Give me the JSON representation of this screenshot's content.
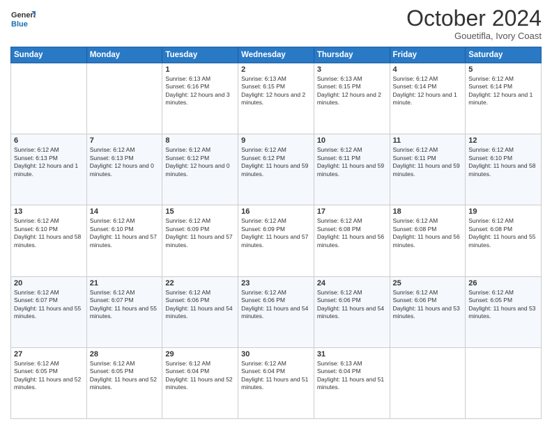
{
  "logo": {
    "line1": "General",
    "line2": "Blue"
  },
  "title": "October 2024",
  "subtitle": "Gouetifla, Ivory Coast",
  "days": [
    "Sunday",
    "Monday",
    "Tuesday",
    "Wednesday",
    "Thursday",
    "Friday",
    "Saturday"
  ],
  "weeks": [
    [
      {
        "day": "",
        "content": ""
      },
      {
        "day": "",
        "content": ""
      },
      {
        "day": "1",
        "content": "Sunrise: 6:13 AM\nSunset: 6:16 PM\nDaylight: 12 hours and 3 minutes."
      },
      {
        "day": "2",
        "content": "Sunrise: 6:13 AM\nSunset: 6:15 PM\nDaylight: 12 hours and 2 minutes."
      },
      {
        "day": "3",
        "content": "Sunrise: 6:13 AM\nSunset: 6:15 PM\nDaylight: 12 hours and 2 minutes."
      },
      {
        "day": "4",
        "content": "Sunrise: 6:12 AM\nSunset: 6:14 PM\nDaylight: 12 hours and 1 minute."
      },
      {
        "day": "5",
        "content": "Sunrise: 6:12 AM\nSunset: 6:14 PM\nDaylight: 12 hours and 1 minute."
      }
    ],
    [
      {
        "day": "6",
        "content": "Sunrise: 6:12 AM\nSunset: 6:13 PM\nDaylight: 12 hours and 1 minute."
      },
      {
        "day": "7",
        "content": "Sunrise: 6:12 AM\nSunset: 6:13 PM\nDaylight: 12 hours and 0 minutes."
      },
      {
        "day": "8",
        "content": "Sunrise: 6:12 AM\nSunset: 6:12 PM\nDaylight: 12 hours and 0 minutes."
      },
      {
        "day": "9",
        "content": "Sunrise: 6:12 AM\nSunset: 6:12 PM\nDaylight: 11 hours and 59 minutes."
      },
      {
        "day": "10",
        "content": "Sunrise: 6:12 AM\nSunset: 6:11 PM\nDaylight: 11 hours and 59 minutes."
      },
      {
        "day": "11",
        "content": "Sunrise: 6:12 AM\nSunset: 6:11 PM\nDaylight: 11 hours and 59 minutes."
      },
      {
        "day": "12",
        "content": "Sunrise: 6:12 AM\nSunset: 6:10 PM\nDaylight: 11 hours and 58 minutes."
      }
    ],
    [
      {
        "day": "13",
        "content": "Sunrise: 6:12 AM\nSunset: 6:10 PM\nDaylight: 11 hours and 58 minutes."
      },
      {
        "day": "14",
        "content": "Sunrise: 6:12 AM\nSunset: 6:10 PM\nDaylight: 11 hours and 57 minutes."
      },
      {
        "day": "15",
        "content": "Sunrise: 6:12 AM\nSunset: 6:09 PM\nDaylight: 11 hours and 57 minutes."
      },
      {
        "day": "16",
        "content": "Sunrise: 6:12 AM\nSunset: 6:09 PM\nDaylight: 11 hours and 57 minutes."
      },
      {
        "day": "17",
        "content": "Sunrise: 6:12 AM\nSunset: 6:08 PM\nDaylight: 11 hours and 56 minutes."
      },
      {
        "day": "18",
        "content": "Sunrise: 6:12 AM\nSunset: 6:08 PM\nDaylight: 11 hours and 56 minutes."
      },
      {
        "day": "19",
        "content": "Sunrise: 6:12 AM\nSunset: 6:08 PM\nDaylight: 11 hours and 55 minutes."
      }
    ],
    [
      {
        "day": "20",
        "content": "Sunrise: 6:12 AM\nSunset: 6:07 PM\nDaylight: 11 hours and 55 minutes."
      },
      {
        "day": "21",
        "content": "Sunrise: 6:12 AM\nSunset: 6:07 PM\nDaylight: 11 hours and 55 minutes."
      },
      {
        "day": "22",
        "content": "Sunrise: 6:12 AM\nSunset: 6:06 PM\nDaylight: 11 hours and 54 minutes."
      },
      {
        "day": "23",
        "content": "Sunrise: 6:12 AM\nSunset: 6:06 PM\nDaylight: 11 hours and 54 minutes."
      },
      {
        "day": "24",
        "content": "Sunrise: 6:12 AM\nSunset: 6:06 PM\nDaylight: 11 hours and 54 minutes."
      },
      {
        "day": "25",
        "content": "Sunrise: 6:12 AM\nSunset: 6:06 PM\nDaylight: 11 hours and 53 minutes."
      },
      {
        "day": "26",
        "content": "Sunrise: 6:12 AM\nSunset: 6:05 PM\nDaylight: 11 hours and 53 minutes."
      }
    ],
    [
      {
        "day": "27",
        "content": "Sunrise: 6:12 AM\nSunset: 6:05 PM\nDaylight: 11 hours and 52 minutes."
      },
      {
        "day": "28",
        "content": "Sunrise: 6:12 AM\nSunset: 6:05 PM\nDaylight: 11 hours and 52 minutes."
      },
      {
        "day": "29",
        "content": "Sunrise: 6:12 AM\nSunset: 6:04 PM\nDaylight: 11 hours and 52 minutes."
      },
      {
        "day": "30",
        "content": "Sunrise: 6:12 AM\nSunset: 6:04 PM\nDaylight: 11 hours and 51 minutes."
      },
      {
        "day": "31",
        "content": "Sunrise: 6:13 AM\nSunset: 6:04 PM\nDaylight: 11 hours and 51 minutes."
      },
      {
        "day": "",
        "content": ""
      },
      {
        "day": "",
        "content": ""
      }
    ]
  ]
}
